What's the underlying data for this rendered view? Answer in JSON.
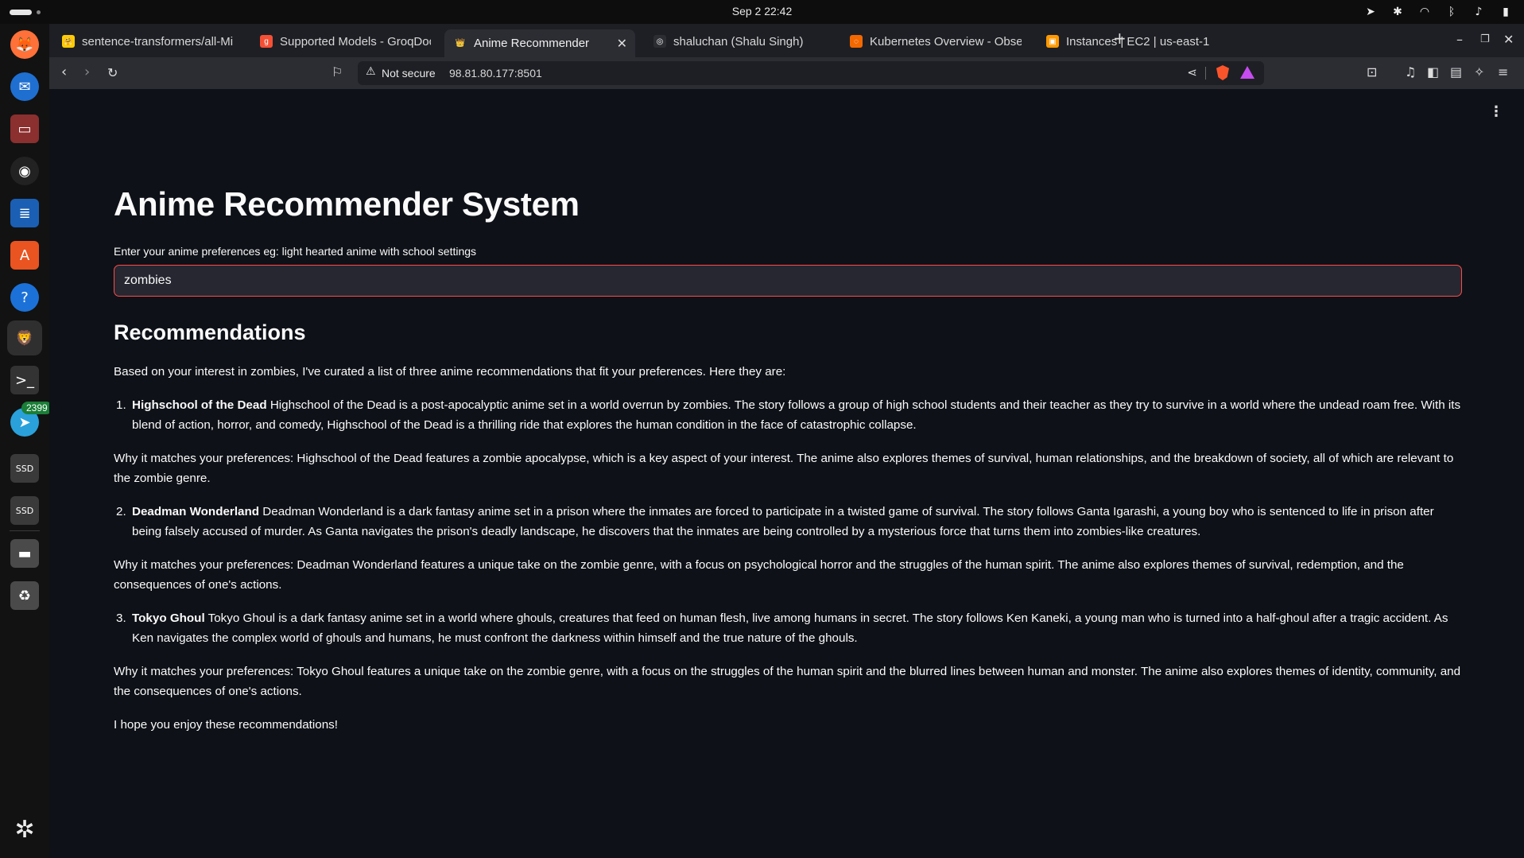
{
  "system_bar": {
    "clock": "Sep 2  22:42"
  },
  "dock": {
    "items": [
      {
        "name": "firefox-icon",
        "glyph": "🦊"
      },
      {
        "name": "thunderbird-icon",
        "glyph": "✉"
      },
      {
        "name": "files-icon",
        "glyph": "▭"
      },
      {
        "name": "rhythmbox-icon",
        "glyph": "◉"
      },
      {
        "name": "writer-icon",
        "glyph": "≣"
      },
      {
        "name": "app-center-icon",
        "glyph": "A"
      },
      {
        "name": "help-icon",
        "glyph": "?"
      },
      {
        "name": "brave-icon",
        "glyph": "🦁"
      },
      {
        "name": "terminal-icon",
        "glyph": ">_"
      },
      {
        "name": "telegram-icon",
        "glyph": "➤"
      },
      {
        "name": "ssd-drive-icon-1",
        "glyph": "SSD"
      },
      {
        "name": "ssd-drive-icon-2",
        "glyph": "SSD"
      },
      {
        "name": "drive-icon",
        "glyph": "▬"
      },
      {
        "name": "trash-icon",
        "glyph": "♻"
      }
    ],
    "telegram_badge": "2399",
    "show_apps_glyph": "✲"
  },
  "tabs": [
    {
      "title": "sentence-transformers/all-Mi",
      "favicon_color": "#ffcc00",
      "favicon": "🤗"
    },
    {
      "title": "Supported Models - GroqDoc",
      "favicon_color": "#f55036",
      "favicon": "g"
    },
    {
      "title": "Anime Recommender",
      "favicon_color": "#2c2d33",
      "favicon": "👑",
      "active": true
    },
    {
      "title": "shaluchan (Shalu Singh)",
      "favicon_color": "#2c2d33",
      "favicon": "◎"
    },
    {
      "title": "Kubernetes Overview - Obse",
      "favicon_color": "#f46800",
      "favicon": "◌"
    },
    {
      "title": "Instances | EC2 | us-east-1",
      "favicon_color": "#ff9900",
      "favicon": "▣"
    }
  ],
  "address_bar": {
    "security_label": "Not secure",
    "url": "98.81.80.177:8501"
  },
  "page": {
    "title": "Anime Recommender System",
    "input_label": "Enter your anime preferences eg: light hearted anime with school settings",
    "input_value": "zombies",
    "section_heading": "Recommendations",
    "intro": "Based on your interest in zombies, I've curated a list of three anime recommendations that fit your preferences. Here they are:",
    "recommendations": [
      {
        "number": "1.",
        "title": "Highschool of the Dead",
        "description": " Highschool of the Dead is a post-apocalyptic anime set in a world overrun by zombies. The story follows a group of high school students and their teacher as they try to survive in a world where the undead roam free. With its blend of action, horror, and comedy, Highschool of the Dead is a thrilling ride that explores the human condition in the face of catastrophic collapse.",
        "why": "Why it matches your preferences: Highschool of the Dead features a zombie apocalypse, which is a key aspect of your interest. The anime also explores themes of survival, human relationships, and the breakdown of society, all of which are relevant to the zombie genre."
      },
      {
        "number": "2.",
        "title": "Deadman Wonderland",
        "description": " Deadman Wonderland is a dark fantasy anime set in a prison where the inmates are forced to participate in a twisted game of survival. The story follows Ganta Igarashi, a young boy who is sentenced to life in prison after being falsely accused of murder. As Ganta navigates the prison's deadly landscape, he discovers that the inmates are being controlled by a mysterious force that turns them into zombies-like creatures.",
        "why": "Why it matches your preferences: Deadman Wonderland features a unique take on the zombie genre, with a focus on psychological horror and the struggles of the human spirit. The anime also explores themes of survival, redemption, and the consequences of one's actions."
      },
      {
        "number": "3.",
        "title": "Tokyo Ghoul",
        "description": " Tokyo Ghoul is a dark fantasy anime set in a world where ghouls, creatures that feed on human flesh, live among humans in secret. The story follows Ken Kaneki, a young man who is turned into a half-ghoul after a tragic accident. As Ken navigates the complex world of ghouls and humans, he must confront the darkness within himself and the true nature of the ghouls.",
        "why": "Why it matches your preferences: Tokyo Ghoul features a unique take on the zombie genre, with a focus on the struggles of the human spirit and the blurred lines between human and monster. The anime also explores themes of identity, community, and the consequences of one's actions."
      }
    ],
    "closing": "I hope you enjoy these recommendations!"
  },
  "colors": {
    "page_background": "#0e1117",
    "input_background": "#262730",
    "input_focus_border": "#ff4b4b",
    "text": "#fafafa"
  }
}
